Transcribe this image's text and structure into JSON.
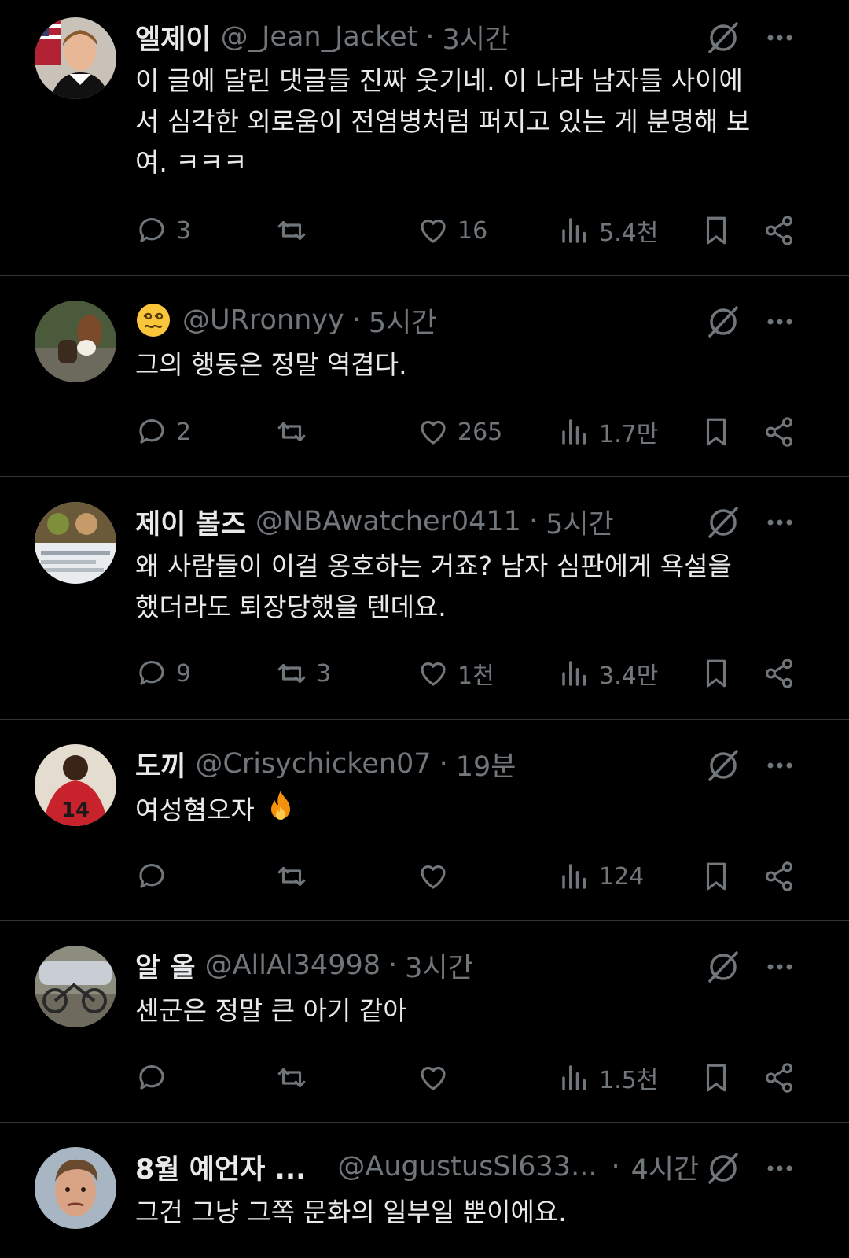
{
  "tweets": [
    {
      "name": "엘제이",
      "handle": "@_Jean_Jacket",
      "sep": "·",
      "time": "3시간",
      "text": "이 글에 달린 댓글들 진짜 웃기네. 이 나라 남자들 사이에\n서 심각한 외로움이 전염병처럼 퍼지고 있는 게 분명해 보\n여. ㅋㅋㅋ",
      "replies": "3",
      "reposts": "",
      "likes": "16",
      "views": "5.4천"
    },
    {
      "name": "",
      "name_emoji": "dizzy-face-emoji",
      "handle": "@URronnyy",
      "sep": "·",
      "time": "5시간",
      "text": "그의 행동은 정말 역겹다.",
      "replies": "2",
      "reposts": "",
      "likes": "265",
      "views": "1.7만"
    },
    {
      "name": "제이 볼즈",
      "handle": "@NBAwatcher0411",
      "sep": "·",
      "time": "5시간",
      "text": "왜 사람들이 이걸 옹호하는 거죠? 남자 심판에게 욕설을\n했더라도 퇴장당했을 텐데요.",
      "replies": "9",
      "reposts": "3",
      "likes": "1천",
      "views": "3.4만"
    },
    {
      "name": "도끼",
      "handle": "@Crisychicken07",
      "sep": "·",
      "time": "19분",
      "text": "여성혐오자",
      "text_emoji": "fire-emoji",
      "replies": "",
      "reposts": "",
      "likes": "",
      "views": "124"
    },
    {
      "name": "알 올",
      "handle": "@AllAl34998",
      "sep": "·",
      "time": "3시간",
      "text": "센군은 정말 큰 아기 같아",
      "replies": "",
      "reposts": "",
      "likes": "",
      "views": "1.5천"
    },
    {
      "name": "8월 예언자 ...",
      "handle": "@AugustusSl633...",
      "sep": "·",
      "time": "4시간",
      "text": "그건 그냥 그쪽 문화의 일부일 뿐이에요.",
      "replies": "",
      "reposts": "",
      "likes": "",
      "views": ""
    }
  ],
  "icons": {
    "reply": "reply-icon",
    "repost": "repost-icon",
    "like": "like-icon",
    "views": "views-icon",
    "bookmark": "bookmark-icon",
    "share": "share-icon",
    "grok": "grok-icon",
    "more": "more-icon"
  },
  "colors": {
    "background": "#000000",
    "text": "#e7e9ea",
    "muted": "#71767b",
    "divider": "#2f3336"
  }
}
